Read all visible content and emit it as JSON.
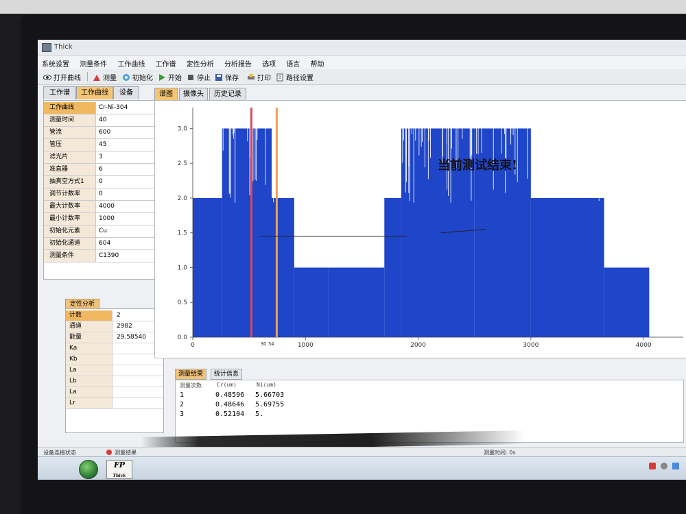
{
  "window": {
    "title": "Thick"
  },
  "menu": [
    "系统设置",
    "测量条件",
    "工作曲线",
    "工作谱",
    "定性分析",
    "分析报告",
    "选项",
    "语言",
    "帮助"
  ],
  "toolbar": {
    "open_curve": "打开曲线",
    "measure": "测量",
    "initialize": "初始化",
    "start": "开始",
    "stop": "停止",
    "save": "保存",
    "print": "打印",
    "path_settings": "路径设置"
  },
  "left_tabs": [
    "工作谱",
    "工作曲线",
    "设备"
  ],
  "params": [
    {
      "k": "工作曲线",
      "v": "Cr-Ni-304"
    },
    {
      "k": "测量时间",
      "v": "40"
    },
    {
      "k": "管流",
      "v": "600"
    },
    {
      "k": "管压",
      "v": "45"
    },
    {
      "k": "滤光片",
      "v": "3"
    },
    {
      "k": "准直器",
      "v": "6"
    },
    {
      "k": "抽真空方式1",
      "v": "0"
    },
    {
      "k": "调节计数率",
      "v": "0"
    },
    {
      "k": "最大计数率",
      "v": "4000"
    },
    {
      "k": "最小计数率",
      "v": "1000"
    },
    {
      "k": "初始化元素",
      "v": "Cu"
    },
    {
      "k": "初始化通道",
      "v": "604"
    },
    {
      "k": "测量条件",
      "v": "C1390"
    }
  ],
  "qualitative": {
    "header": "定性分析",
    "rows": [
      {
        "k": "计数",
        "v": "2"
      },
      {
        "k": "通道",
        "v": "2982"
      },
      {
        "k": "能量",
        "v": "29.58540"
      },
      {
        "k": "Ka",
        "v": ""
      },
      {
        "k": "Kb",
        "v": ""
      },
      {
        "k": "La",
        "v": ""
      },
      {
        "k": "Lb",
        "v": ""
      },
      {
        "k": "La",
        "v": ""
      },
      {
        "k": "Lr",
        "v": ""
      }
    ]
  },
  "right_tabs": [
    "谱图",
    "摄像头",
    "历史记录"
  ],
  "chart": {
    "message": "当前测试结束!",
    "cursor_label": "30  34"
  },
  "chart_data": {
    "type": "bar",
    "xlim": [
      0,
      4200
    ],
    "ylim": [
      0,
      3.3
    ],
    "x_ticks": [
      0,
      1000,
      2000,
      3000,
      4000
    ],
    "y_ticks": [
      0.0,
      0.5,
      1.0,
      1.5,
      2.0,
      2.5,
      3.0
    ],
    "series": [
      {
        "segments": [
          {
            "x0": 0,
            "x1": 260,
            "y": 2.0
          },
          {
            "x0": 260,
            "x1": 700,
            "y": 3.0
          },
          {
            "x0": 700,
            "x1": 900,
            "y": 2.0
          },
          {
            "x0": 900,
            "x1": 1200,
            "y": 1.0
          },
          {
            "x0": 1200,
            "x1": 1700,
            "y": 1.0
          },
          {
            "x0": 1700,
            "x1": 1850,
            "y": 2.0
          },
          {
            "x0": 1850,
            "x1": 2500,
            "y": 3.0
          },
          {
            "x0": 2500,
            "x1": 3000,
            "y": 3.0
          },
          {
            "x0": 3000,
            "x1": 3650,
            "y": 2.0
          },
          {
            "x0": 3650,
            "x1": 4050,
            "y": 1.0
          }
        ]
      }
    ],
    "markers": [
      {
        "x": 520,
        "color": "#e0465a"
      },
      {
        "x": 745,
        "color": "#f0a050"
      }
    ]
  },
  "results": {
    "tabs": [
      "测量结果",
      "统计信息"
    ],
    "headers": [
      "测量次数",
      "Cr(um)",
      "Ni(um)"
    ],
    "rows": [
      [
        "1",
        "0.48596",
        "5.66703"
      ],
      [
        "2",
        "0.48646",
        "5.69755"
      ],
      [
        "3",
        "0.52104",
        "5."
      ]
    ]
  },
  "statusbar": {
    "left": "设备连接状态",
    "mid": "测量结果",
    "right": "测量时间: 0s"
  }
}
